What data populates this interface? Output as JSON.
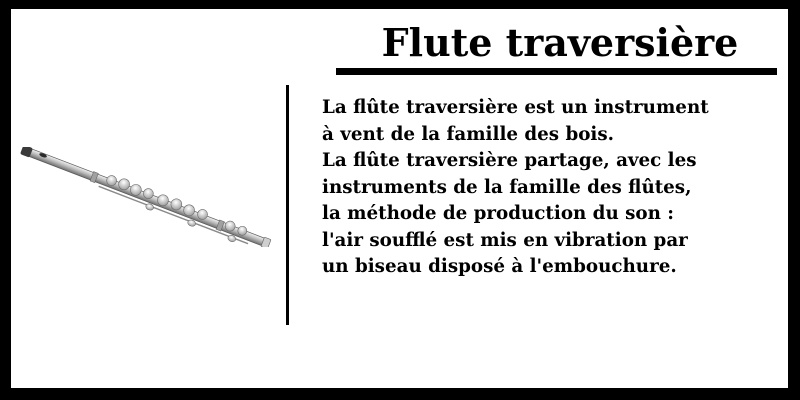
{
  "title": "Flute traversière",
  "image": {
    "icon": "transverse-flute-illustration"
  },
  "description": {
    "lines": [
      "La flûte traversière est un instrument",
      "à vent de la famille des bois.",
      "La flûte traversière partage, avec les",
      "instruments de la famille des flûtes,",
      "la méthode de production du son :",
      "l'air soufflé est mis en vibration par",
      "un biseau disposé à l'embouchure."
    ]
  },
  "colors": {
    "frame": "#000000",
    "background": "#ffffff",
    "text": "#000000"
  }
}
